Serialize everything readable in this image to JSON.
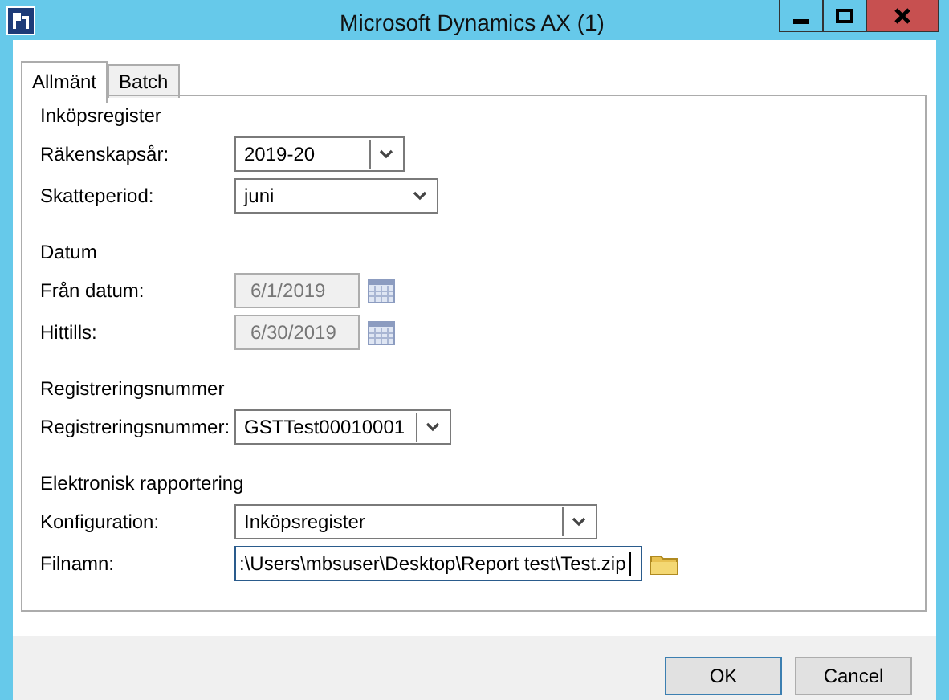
{
  "window": {
    "title": "Microsoft Dynamics AX (1)"
  },
  "tabs": [
    {
      "label": "Allmänt",
      "selected": true
    },
    {
      "label": "Batch",
      "selected": false
    }
  ],
  "sections": [
    {
      "heading": "Inköpsregister",
      "fields": [
        {
          "label": "Räkenskapsår:",
          "value": "2019-20",
          "kind": "combo",
          "disabled": false,
          "focused": false
        },
        {
          "label": "Skatteperiod:",
          "value": "juni",
          "kind": "dropdown",
          "disabled": false,
          "focused": false
        }
      ]
    },
    {
      "heading": "Datum",
      "fields": [
        {
          "label": "Från datum:",
          "value": "6/1/2019",
          "kind": "date",
          "disabled": true,
          "focused": false
        },
        {
          "label": "Hittills:",
          "value": "6/30/2019",
          "kind": "date",
          "disabled": true,
          "focused": false
        }
      ]
    },
    {
      "heading": "Registreringsnummer",
      "fields": [
        {
          "label": "Registreringsnummer:",
          "value": "GSTTest00010001",
          "kind": "combo",
          "disabled": false,
          "focused": false
        }
      ]
    },
    {
      "heading": "Elektronisk rapportering",
      "fields": [
        {
          "label": "Konfiguration:",
          "value": "Inköpsregister",
          "kind": "combo",
          "disabled": false,
          "focused": false
        },
        {
          "label": "Filnamn:",
          "value": ":\\Users\\mbsuser\\Desktop\\Report test\\Test.zip",
          "kind": "file",
          "disabled": false,
          "focused": true
        }
      ]
    }
  ],
  "buttons": [
    "OK",
    "Cancel"
  ]
}
